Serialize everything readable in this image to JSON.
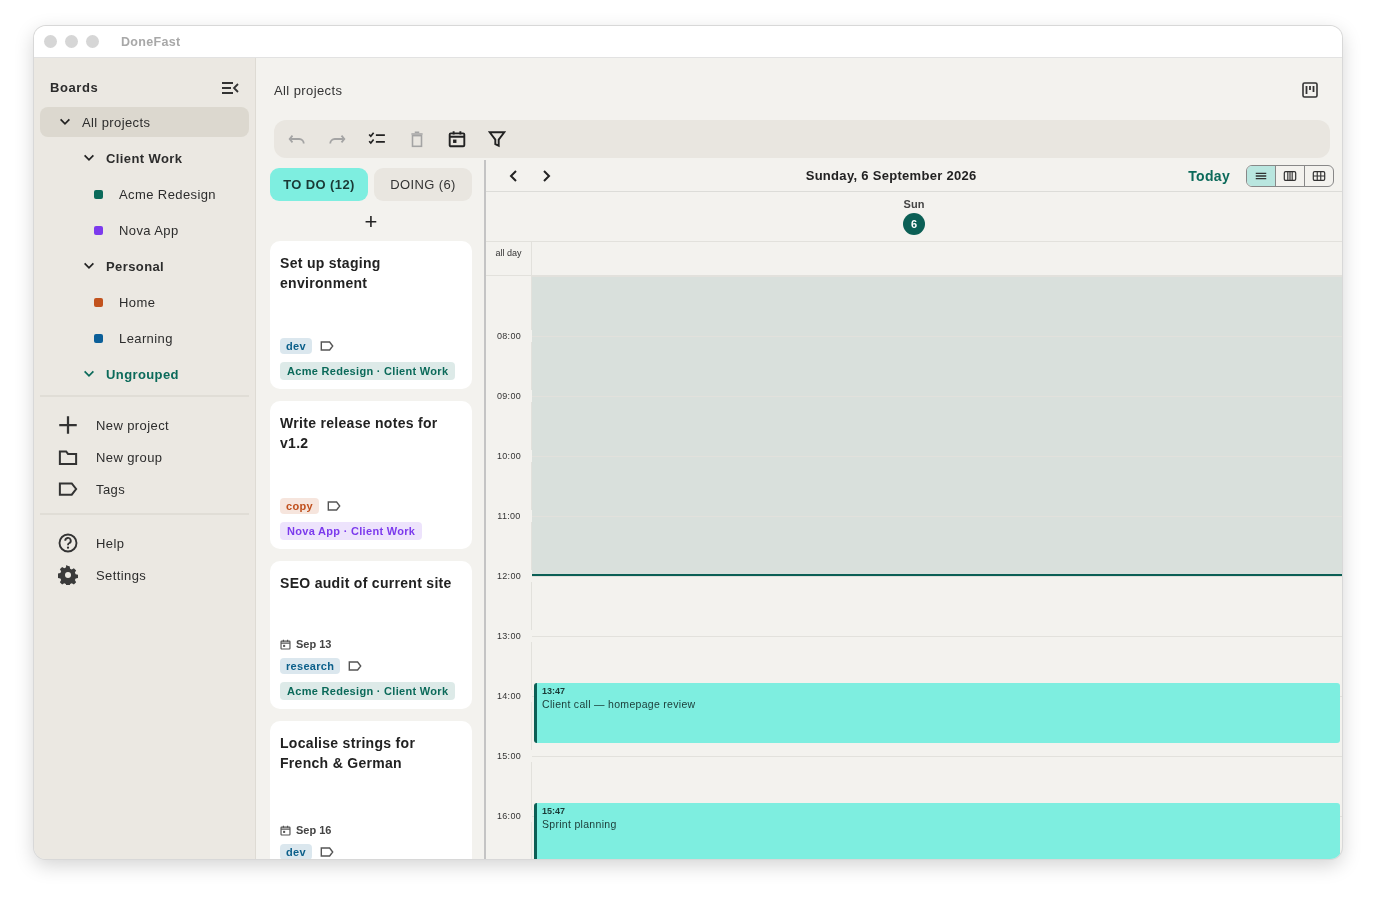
{
  "window": {
    "title": "DoneFast"
  },
  "sidebar": {
    "title": "Boards",
    "tree": [
      {
        "label": "All projects",
        "expanded": true,
        "selected": true,
        "highlighted": false,
        "children": [
          {
            "label": "Client Work",
            "expanded": true,
            "selected": false,
            "highlighted": false,
            "children": [
              {
                "label": "Acme Redesign",
                "color": "#0b6a5a",
                "selected": false
              },
              {
                "label": "Nova App",
                "color": "#7c3aed",
                "selected": false
              }
            ]
          },
          {
            "label": "Personal",
            "expanded": true,
            "selected": false,
            "highlighted": false,
            "children": [
              {
                "label": "Home",
                "color": "#c2521d",
                "selected": false
              },
              {
                "label": "Learning",
                "color": "#0b5f99",
                "selected": false
              }
            ]
          },
          {
            "label": "Ungrouped",
            "expanded": true,
            "selected": false,
            "highlighted": true
          }
        ]
      }
    ],
    "actions": [
      {
        "kind": "plus",
        "label": "New project"
      },
      {
        "kind": "folder",
        "label": "New group"
      },
      {
        "kind": "tag",
        "label": "Tags"
      }
    ],
    "footer": [
      {
        "kind": "help",
        "label": "Help"
      },
      {
        "kind": "gear",
        "label": "Settings"
      }
    ]
  },
  "header": {
    "title": "All projects"
  },
  "toolbar": [
    {
      "kind": "undo",
      "disabled": true
    },
    {
      "kind": "redo",
      "disabled": true
    },
    {
      "kind": "checklist",
      "disabled": false
    },
    {
      "kind": "trash",
      "disabled": true
    },
    {
      "kind": "calendar",
      "disabled": false
    },
    {
      "kind": "filter",
      "disabled": false
    }
  ],
  "board": {
    "tabs": [
      {
        "label": "TO DO (12)",
        "selected": true
      },
      {
        "label": "DOING (6)",
        "selected": false
      }
    ],
    "add_button": "+",
    "cards": [
      {
        "title": "Set up staging environment",
        "tags": [
          {
            "label": "dev",
            "color": "#0b5f8a"
          }
        ],
        "project": {
          "label": "Acme Redesign · Client Work",
          "color": "#0b6a5a"
        }
      },
      {
        "title": "Write release notes for v1.2",
        "tags": [
          {
            "label": "copy",
            "color": "#c0501d"
          }
        ],
        "project": {
          "label": "Nova App · Client Work",
          "color": "#7c3aed"
        }
      },
      {
        "title": "SEO audit of current site",
        "due": "Sep 13",
        "tags": [
          {
            "label": "research",
            "color": "#0b5f8a"
          }
        ],
        "project": {
          "label": "Acme Redesign · Client Work",
          "color": "#0b6a5a"
        }
      },
      {
        "title": "Localise strings for French & German",
        "due": "Sep 16",
        "tags": [
          {
            "label": "dev",
            "color": "#0b5f8a"
          }
        ]
      }
    ]
  },
  "calendar": {
    "date": "Sunday, 6 September 2026",
    "today_button": "Today",
    "views": [
      {
        "kind": "day",
        "selected": true
      },
      {
        "kind": "week",
        "selected": false
      },
      {
        "kind": "month",
        "selected": false
      }
    ],
    "day_name": "Sun",
    "day_number": "6",
    "all_day_label": "all day",
    "hour_slots": [
      {
        "past": true
      },
      {
        "label": "08:00",
        "past": true
      },
      {
        "label": "09:00",
        "past": true
      },
      {
        "label": "10:00",
        "past": true
      },
      {
        "label": "11:00",
        "past": true
      },
      {
        "label": "12:00",
        "past": false
      },
      {
        "label": "13:00",
        "past": false
      },
      {
        "label": "14:00",
        "past": false
      },
      {
        "label": "15:00",
        "past": false
      },
      {
        "label": "16:00",
        "past": false
      }
    ],
    "events": [
      {
        "time": "13:47",
        "title": "Client call — homepage review"
      },
      {
        "time": "15:47",
        "title": "Sprint planning"
      }
    ]
  }
}
